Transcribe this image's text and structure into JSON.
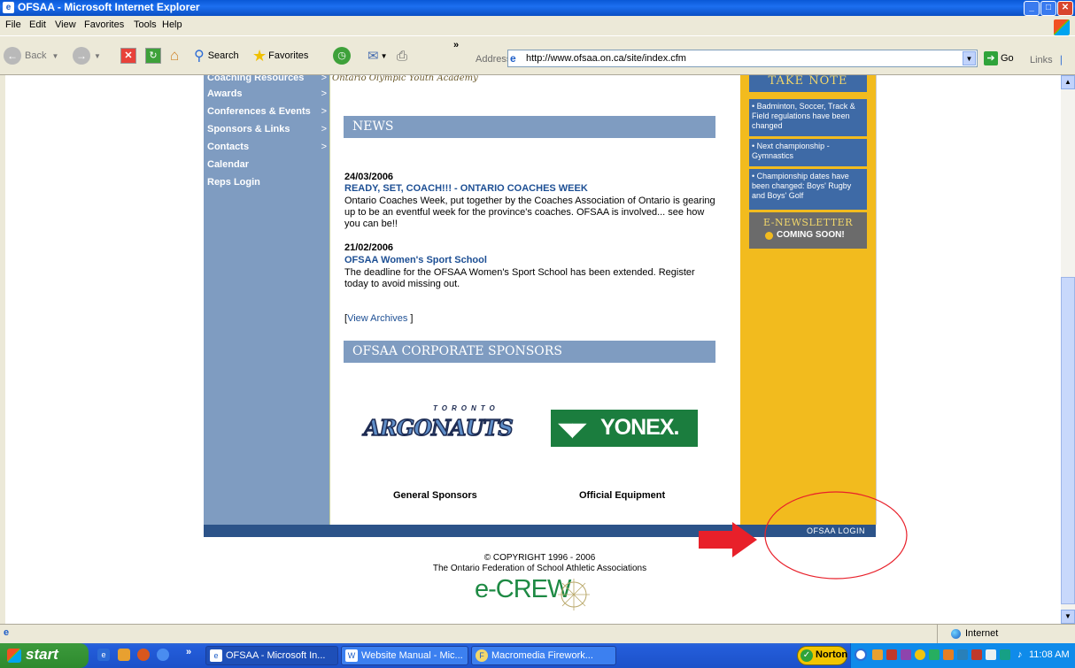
{
  "window": {
    "title": "OFSAA - Microsoft Internet Explorer"
  },
  "menu": [
    "File",
    "Edit",
    "View",
    "Favorites",
    "Tools",
    "Help"
  ],
  "toolbar": {
    "back": "Back",
    "search": "Search",
    "favorites": "Favorites",
    "chevron": "»"
  },
  "address": {
    "label": "Address",
    "url": "http://www.ofsaa.on.ca/site/index.cfm",
    "go": "Go",
    "links": "Links"
  },
  "nav": [
    {
      "label": "Coaching Resources",
      "arrow": ">"
    },
    {
      "label": "Awards",
      "arrow": ">"
    },
    {
      "label": "Conferences & Events",
      "arrow": ">"
    },
    {
      "label": "Sponsors & Links",
      "arrow": ">"
    },
    {
      "label": "Contacts",
      "arrow": ">"
    },
    {
      "label": "Calendar",
      "arrow": ""
    },
    {
      "label": "Reps Login",
      "arrow": ""
    }
  ],
  "academy_text": "Ontario Olympic Youth Academy",
  "news": {
    "heading": "NEWS",
    "items": [
      {
        "date": "24/03/2006",
        "headline": "READY, SET, COACH!!! - ONTARIO COACHES WEEK",
        "body": "Ontario Coaches Week, put together by the Coaches Association of Ontario is gearing up to be an eventful week for the province's coaches. OFSAA is involved... see how you can be!!"
      },
      {
        "date": "21/02/2006",
        "headline": "OFSAA Women's Sport School",
        "body": "The deadline for the OFSAA Women's Sport School has been extended. Register today to avoid missing out."
      }
    ],
    "archives_open": "[",
    "archives_link": "View Archives",
    "archives_close": "]"
  },
  "sponsors": {
    "heading": "OFSAA CORPORATE SPONSORS",
    "argonauts_top": "TORONTO",
    "argonauts_name": "ARGONAUTS",
    "yonex": "YONEX.",
    "general": "General Sponsors",
    "equipment": "Official Equipment"
  },
  "take_note": {
    "heading": "TAKE NOTE",
    "items": [
      "• Badminton, Soccer, Track & Field regulations have been changed",
      "• Next championship - Gymnastics",
      "• Championship dates have been changed: Boys' Rugby and Boys' Golf"
    ],
    "enews_title": "E-NEWSLETTER",
    "enews_sub": "COMING SOON!"
  },
  "footer": {
    "login": "OFSAA LOGIN",
    "copyright": "© COPYRIGHT 1996 - 2006",
    "org": "The Ontario Federation of School Athletic Associations",
    "logo": "e-CREW"
  },
  "status": {
    "zone": "Internet"
  },
  "taskbar": {
    "start": "start",
    "tasks": [
      "OFSAA - Microsoft In...",
      "Website Manual - Mic...",
      "Macromedia Firework..."
    ],
    "norton": "Norton",
    "clock": "11:08 AM"
  },
  "colors": {
    "nav_blue": "#7f9cc1",
    "right_yellow": "#f2bb1e",
    "annotation_red": "#e8202a"
  }
}
